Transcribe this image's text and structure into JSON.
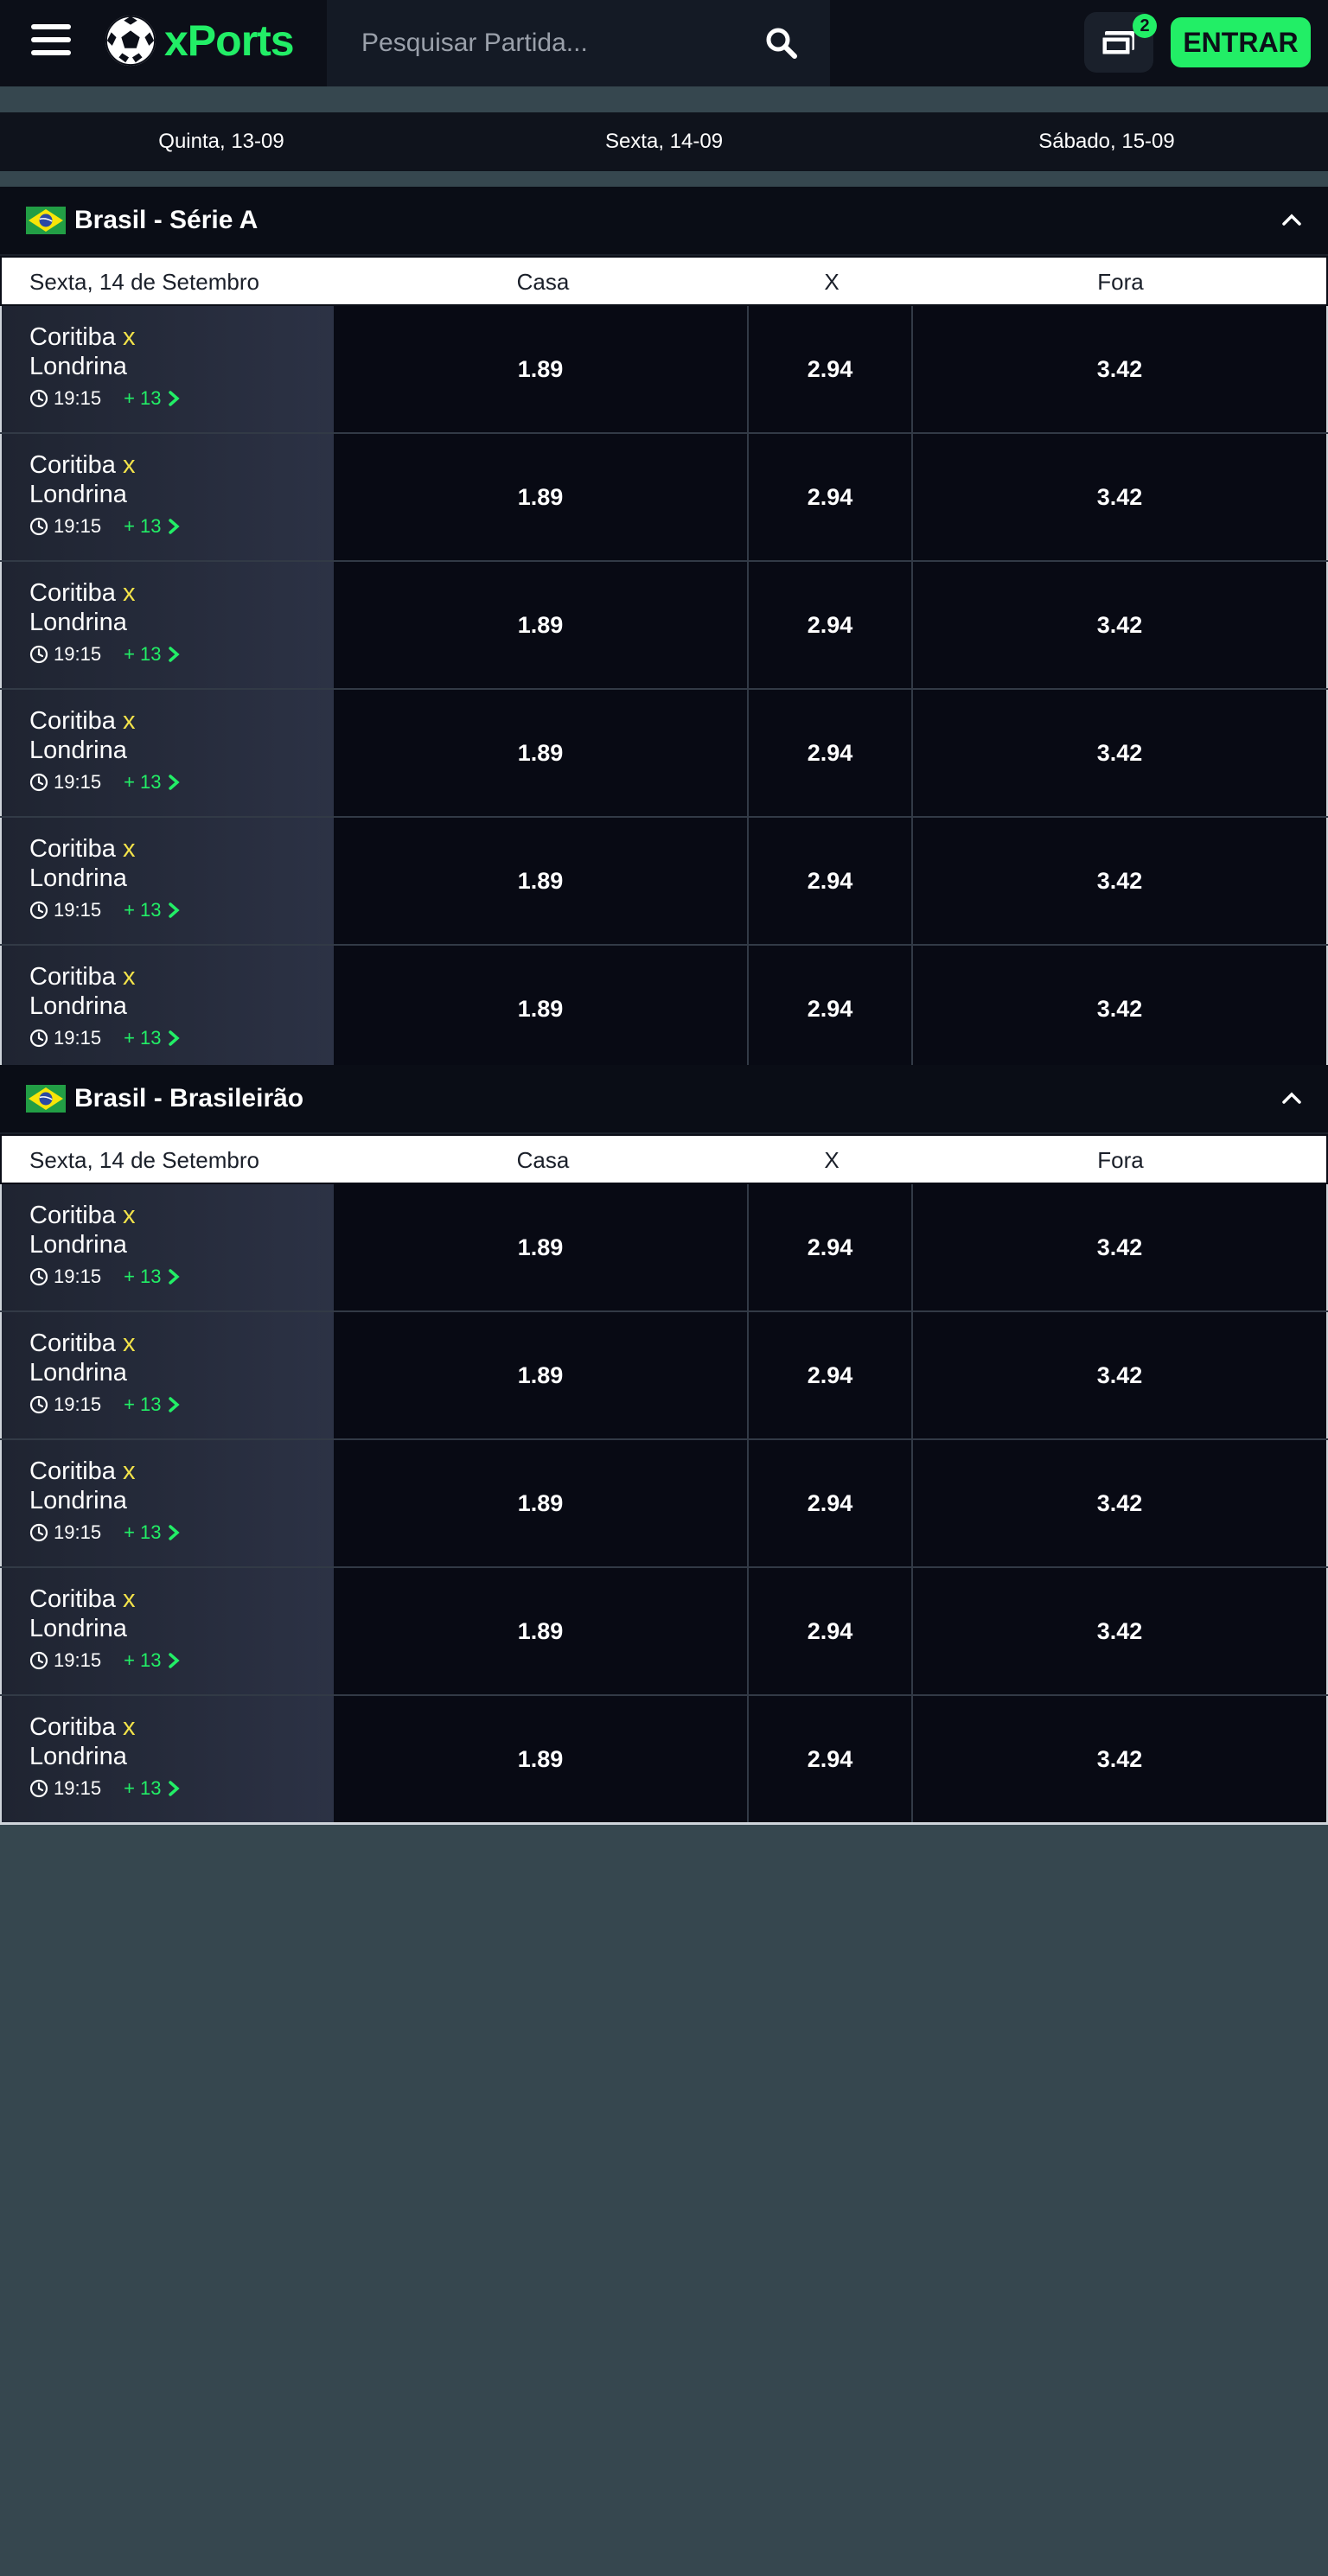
{
  "header": {
    "brand": "xPorts",
    "search_placeholder": "Pesquisar Partida...",
    "bet_count": "2",
    "login_label": "ENTRAR"
  },
  "icons": [
    "menu-icon",
    "soccer-ball-icon",
    "search-icon",
    "ticket-icon",
    "brazil-flag-icon",
    "chevron-up-icon",
    "clock-icon",
    "chevron-right-icon"
  ],
  "colors": {
    "accent": "#22ee66",
    "vs": "#f3e34a",
    "background": "#36474f",
    "header": "#0c0f18"
  },
  "date_tabs": [
    "Quinta, 13-09",
    "Sexta, 14-09",
    "Sábado, 15-09"
  ],
  "sections": [
    {
      "title": "Brasil - Série A",
      "columns": {
        "date": "Sexta, 14 de Setembro",
        "home": "Casa",
        "draw": "X",
        "away": "Fora"
      },
      "matches": [
        {
          "home": "Coritiba",
          "vs": "x",
          "away": "Londrina",
          "time": "19:15",
          "more": "+ 13",
          "odds": [
            "1.89",
            "2.94",
            "3.42"
          ]
        },
        {
          "home": "Coritiba",
          "vs": "x",
          "away": "Londrina",
          "time": "19:15",
          "more": "+ 13",
          "odds": [
            "1.89",
            "2.94",
            "3.42"
          ]
        },
        {
          "home": "Coritiba",
          "vs": "x",
          "away": "Londrina",
          "time": "19:15",
          "more": "+ 13",
          "odds": [
            "1.89",
            "2.94",
            "3.42"
          ]
        },
        {
          "home": "Coritiba",
          "vs": "x",
          "away": "Londrina",
          "time": "19:15",
          "more": "+ 13",
          "odds": [
            "1.89",
            "2.94",
            "3.42"
          ]
        },
        {
          "home": "Coritiba",
          "vs": "x",
          "away": "Londrina",
          "time": "19:15",
          "more": "+ 13",
          "odds": [
            "1.89",
            "2.94",
            "3.42"
          ]
        },
        {
          "home": "Coritiba",
          "vs": "x",
          "away": "Londrina",
          "time": "19:15",
          "more": "+ 13",
          "odds": [
            "1.89",
            "2.94",
            "3.42"
          ]
        }
      ]
    },
    {
      "title": "Brasil - Brasileirão",
      "columns": {
        "date": "Sexta, 14 de Setembro",
        "home": "Casa",
        "draw": "X",
        "away": "Fora"
      },
      "matches": [
        {
          "home": "Coritiba",
          "vs": "x",
          "away": "Londrina",
          "time": "19:15",
          "more": "+ 13",
          "odds": [
            "1.89",
            "2.94",
            "3.42"
          ]
        },
        {
          "home": "Coritiba",
          "vs": "x",
          "away": "Londrina",
          "time": "19:15",
          "more": "+ 13",
          "odds": [
            "1.89",
            "2.94",
            "3.42"
          ]
        },
        {
          "home": "Coritiba",
          "vs": "x",
          "away": "Londrina",
          "time": "19:15",
          "more": "+ 13",
          "odds": [
            "1.89",
            "2.94",
            "3.42"
          ]
        },
        {
          "home": "Coritiba",
          "vs": "x",
          "away": "Londrina",
          "time": "19:15",
          "more": "+ 13",
          "odds": [
            "1.89",
            "2.94",
            "3.42"
          ]
        },
        {
          "home": "Coritiba",
          "vs": "x",
          "away": "Londrina",
          "time": "19:15",
          "more": "+ 13",
          "odds": [
            "1.89",
            "2.94",
            "3.42"
          ]
        }
      ]
    }
  ]
}
